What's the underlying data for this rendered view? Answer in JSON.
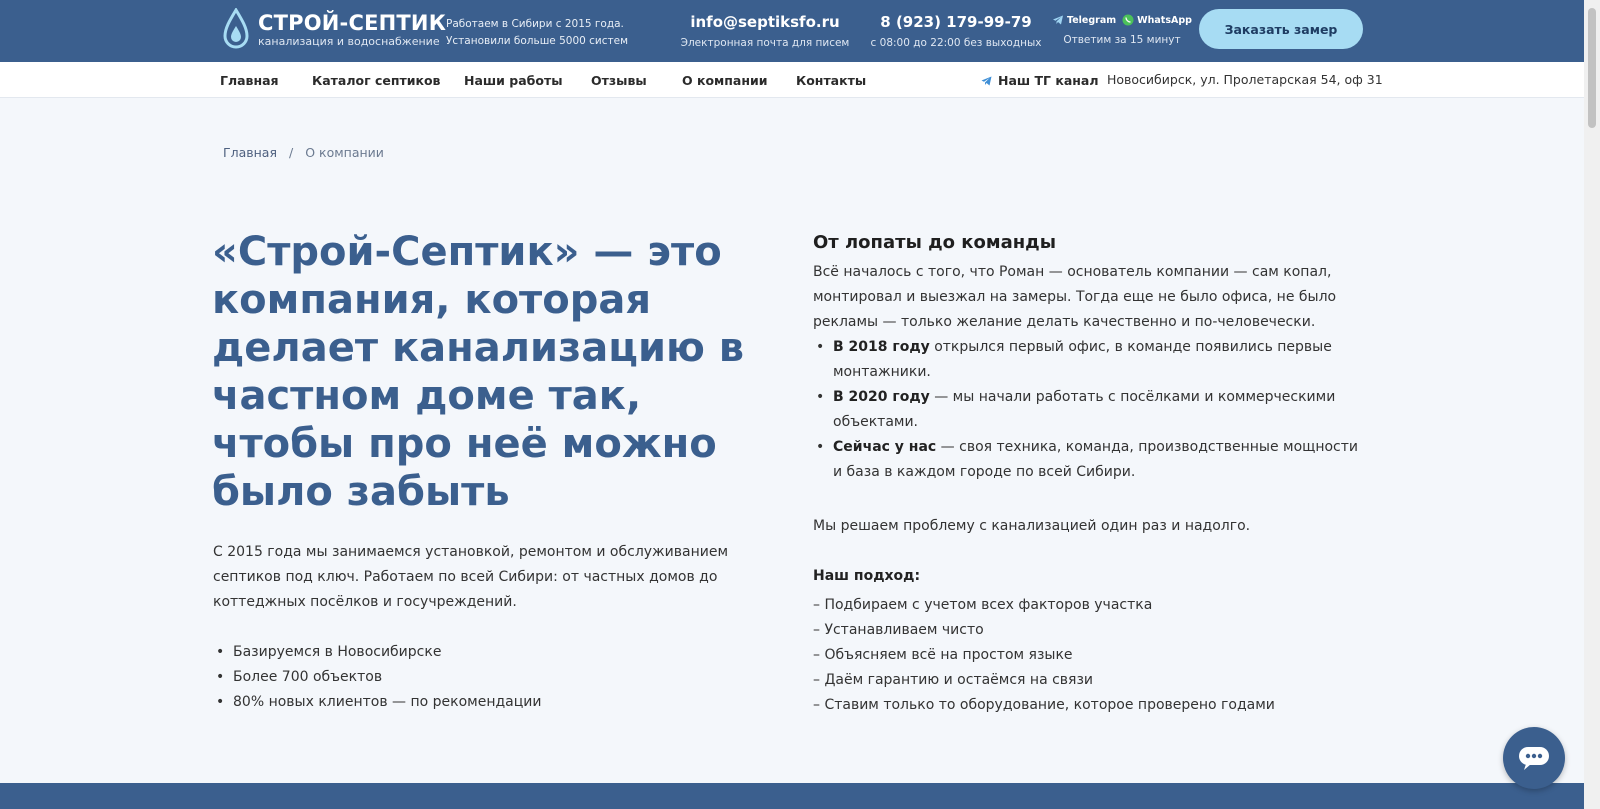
{
  "header": {
    "logo_title": "СТРОЙ-СЕПТИК",
    "logo_subtitle": "канализация и водоснабжение",
    "tagline_line1": "Работаем в Сибири с 2015 года.",
    "tagline_line2": "Установили больше 5000 систем",
    "email": "info@septiksfo.ru",
    "email_caption": "Электронная почта для писем",
    "phone": "8 (923) 179-99-79",
    "phone_caption": "с 08:00 до 22:00 без выходных",
    "telegram_label": "Telegram",
    "whatsapp_label": "WhatsApp",
    "messengers_caption": "Ответим за 15 минут",
    "order_button": "Заказать замер",
    "colors": {
      "primary": "#3b5f8e",
      "button": "#a7dcf3"
    }
  },
  "nav": {
    "items": [
      "Главная",
      "Каталог септиков",
      "Наши работы",
      "Отзывы",
      "О компании",
      "Контакты"
    ],
    "tg_channel": "Наш ТГ канал",
    "address": "Новосибирск, ул. Пролетарская 54, оф 31"
  },
  "breadcrumb": {
    "home": "Главная",
    "separator": "/",
    "current": "О компании"
  },
  "hero": {
    "title": "«Строй-Септик» — это компания, которая делает канализацию в частном доме так, чтобы про неё можно было забыть",
    "description": "С 2015 года мы занимаемся установкой, ремонтом и обслуживанием септиков под ключ. Работаем по всей Сибири: от частных домов до коттеджных посёлков и госучреждений.",
    "bullets": [
      "Базируемся в Новосибирске",
      "Более 700 объектов",
      "80% новых клиентов — по рекомендации"
    ]
  },
  "story": {
    "title": "От лопаты до команды",
    "intro": "Всё началось с того, что Роман — основатель компании — сам копал, монтировал и выезжал на замеры. Тогда еще не было офиса, не было рекламы — только желание делать качественно и по-человечески.",
    "milestones": [
      {
        "label": "В 2018 году",
        "text": " открылся первый офис, в команде появились первые монтажники."
      },
      {
        "label": "В 2020 году",
        "text": " — мы начали работать с посёлками и коммерческими объектами."
      },
      {
        "label": "Сейчас у нас",
        "text": " — своя техника, команда, производственные мощности и база в каждом городе по всей Сибири."
      }
    ],
    "solve": "Мы решаем проблему с канализацией один раз и надолго.",
    "approach_title": "Наш подход:",
    "approach": [
      "– Подбираем с учетом всех факторов участка",
      "– Устанавливаем чисто",
      "– Объясняем всё на простом языке",
      "– Даём гарантию и остаёмся на связи",
      "– Ставим только то оборудование, которое проверено годами"
    ]
  },
  "icons": {
    "logo": "water-drop-icon",
    "telegram": "telegram-icon",
    "whatsapp": "whatsapp-icon",
    "chat": "chat-icon"
  }
}
